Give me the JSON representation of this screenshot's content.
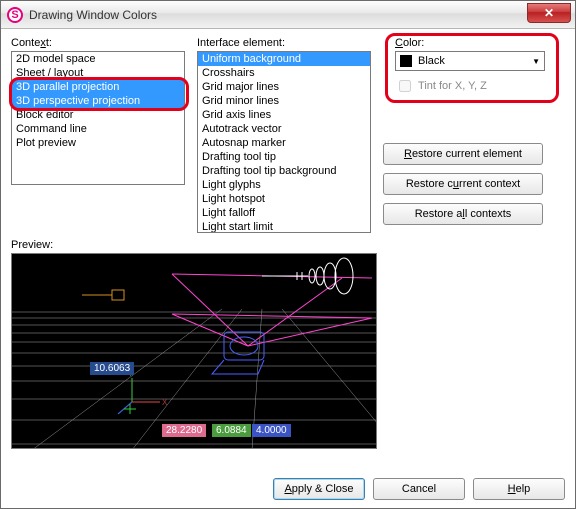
{
  "window": {
    "app_icon_letter": "S",
    "title": "Drawing Window Colors",
    "close_glyph": "✕"
  },
  "labels": {
    "context_pre": "Conte",
    "context_u": "x",
    "context_post": "t:",
    "iface": "Interface element:",
    "color_u": "C",
    "color_post": "olor:",
    "tint_u": "T",
    "tint_post": "int for X, Y, Z",
    "restore_elem_pre": "",
    "restore_elem_u": "R",
    "restore_elem_post": "estore current element",
    "restore_ctx_pre": "Restore c",
    "restore_ctx_u": "u",
    "restore_ctx_post": "rrent context",
    "restore_all_pre": "Restore a",
    "restore_all_u": "l",
    "restore_all_post": "l contexts",
    "preview": "Preview:",
    "apply_pre": "",
    "apply_u": "A",
    "apply_post": "pply & Close",
    "cancel": "Cancel",
    "help_u": "H",
    "help_post": "elp"
  },
  "context_items": [
    "2D model space",
    "Sheet / layout",
    "3D parallel projection",
    "3D perspective projection",
    "Block editor",
    "Command line",
    "Plot preview"
  ],
  "context_selected": [
    2,
    3
  ],
  "iface_items": [
    "Uniform background",
    "Crosshairs",
    "Grid major lines",
    "Grid minor lines",
    "Grid axis lines",
    "Autotrack vector",
    "Autosnap marker",
    "Drafting tool tip",
    "Drafting tool tip background",
    "Light glyphs",
    "Light hotspot",
    "Light falloff",
    "Light start limit"
  ],
  "iface_selected": [
    0
  ],
  "color": {
    "name": "Black",
    "hex": "#000000"
  },
  "preview_values": {
    "dim1": "10.6063",
    "dim2": "28.2280",
    "dim3": "6.0884",
    "dim4": "4.0000"
  }
}
